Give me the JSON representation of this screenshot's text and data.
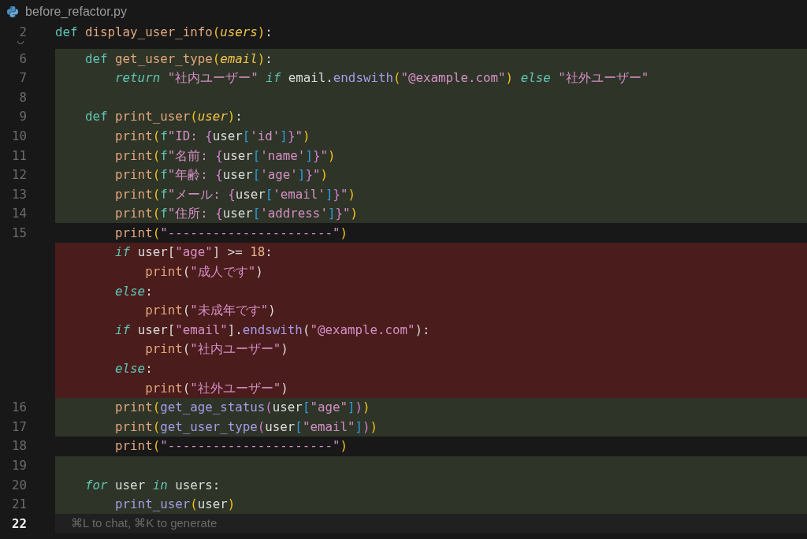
{
  "tab": {
    "title": "before_refactor.py"
  },
  "lines": [
    {
      "number": "2",
      "kind": "normal",
      "tokens": [
        {
          "kind": "kw",
          "text": "def "
        },
        {
          "kind": "fn",
          "text": "display_user_info"
        },
        {
          "kind": "p1",
          "text": "("
        },
        {
          "kind": "param",
          "text": "users"
        },
        {
          "kind": "p1",
          "text": ")"
        },
        {
          "kind": "id",
          "text": ":"
        }
      ]
    },
    {
      "number": "6",
      "kind": "added",
      "folded_before": true,
      "tokens": [
        {
          "kind": "kw",
          "text": "    def "
        },
        {
          "kind": "fn",
          "text": "get_user_type"
        },
        {
          "kind": "p1",
          "text": "("
        },
        {
          "kind": "param",
          "text": "email"
        },
        {
          "kind": "p1",
          "text": ")"
        },
        {
          "kind": "id",
          "text": ":"
        }
      ]
    },
    {
      "number": "7",
      "kind": "added",
      "tokens": [
        {
          "kind": "kwi",
          "text": "        return "
        },
        {
          "kind": "str",
          "text": "\"社内ユーザー\" "
        },
        {
          "kind": "kwi",
          "text": "if "
        },
        {
          "kind": "id",
          "text": "email."
        },
        {
          "kind": "method",
          "text": "endswith"
        },
        {
          "kind": "p1",
          "text": "("
        },
        {
          "kind": "str",
          "text": "\"@example.com\""
        },
        {
          "kind": "p1",
          "text": ")"
        },
        {
          "kind": "kwi",
          "text": " else "
        },
        {
          "kind": "str",
          "text": "\"社外ユーザー\""
        }
      ]
    },
    {
      "number": "8",
      "kind": "added"
    },
    {
      "number": "9",
      "kind": "added",
      "tokens": [
        {
          "kind": "kw",
          "text": "    def "
        },
        {
          "kind": "fn",
          "text": "print_user"
        },
        {
          "kind": "p1",
          "text": "("
        },
        {
          "kind": "param",
          "text": "user"
        },
        {
          "kind": "p1",
          "text": ")"
        },
        {
          "kind": "id",
          "text": ":"
        }
      ]
    },
    {
      "number": "10",
      "kind": "added",
      "tokens": [
        {
          "kind": "fn",
          "text": "        print"
        },
        {
          "kind": "p1",
          "text": "("
        },
        {
          "kind": "kw",
          "text": "f"
        },
        {
          "kind": "str",
          "text": "\"ID: "
        },
        {
          "kind": "p2",
          "text": "{"
        },
        {
          "kind": "id",
          "text": "user"
        },
        {
          "kind": "p3",
          "text": "["
        },
        {
          "kind": "str",
          "text": "'id'"
        },
        {
          "kind": "p3",
          "text": "]"
        },
        {
          "kind": "p2",
          "text": "}"
        },
        {
          "kind": "str",
          "text": "\""
        },
        {
          "kind": "p1",
          "text": ")"
        }
      ]
    },
    {
      "number": "11",
      "kind": "added",
      "tokens": [
        {
          "kind": "fn",
          "text": "        print"
        },
        {
          "kind": "p1",
          "text": "("
        },
        {
          "kind": "kw",
          "text": "f"
        },
        {
          "kind": "str",
          "text": "\"名前: "
        },
        {
          "kind": "p2",
          "text": "{"
        },
        {
          "kind": "id",
          "text": "user"
        },
        {
          "kind": "p3",
          "text": "["
        },
        {
          "kind": "str",
          "text": "'name'"
        },
        {
          "kind": "p3",
          "text": "]"
        },
        {
          "kind": "p2",
          "text": "}"
        },
        {
          "kind": "str",
          "text": "\""
        },
        {
          "kind": "p1",
          "text": ")"
        }
      ]
    },
    {
      "number": "12",
      "kind": "added",
      "tokens": [
        {
          "kind": "fn",
          "text": "        print"
        },
        {
          "kind": "p1",
          "text": "("
        },
        {
          "kind": "kw",
          "text": "f"
        },
        {
          "kind": "str",
          "text": "\"年齢: "
        },
        {
          "kind": "p2",
          "text": "{"
        },
        {
          "kind": "id",
          "text": "user"
        },
        {
          "kind": "p3",
          "text": "["
        },
        {
          "kind": "str",
          "text": "'age'"
        },
        {
          "kind": "p3",
          "text": "]"
        },
        {
          "kind": "p2",
          "text": "}"
        },
        {
          "kind": "str",
          "text": "\""
        },
        {
          "kind": "p1",
          "text": ")"
        }
      ]
    },
    {
      "number": "13",
      "kind": "added",
      "tokens": [
        {
          "kind": "fn",
          "text": "        print"
        },
        {
          "kind": "p1",
          "text": "("
        },
        {
          "kind": "kw",
          "text": "f"
        },
        {
          "kind": "str",
          "text": "\"メール: "
        },
        {
          "kind": "p2",
          "text": "{"
        },
        {
          "kind": "id",
          "text": "user"
        },
        {
          "kind": "p3",
          "text": "["
        },
        {
          "kind": "str",
          "text": "'email'"
        },
        {
          "kind": "p3",
          "text": "]"
        },
        {
          "kind": "p2",
          "text": "}"
        },
        {
          "kind": "str",
          "text": "\""
        },
        {
          "kind": "p1",
          "text": ")"
        }
      ]
    },
    {
      "number": "14",
      "kind": "added",
      "tokens": [
        {
          "kind": "fn",
          "text": "        print"
        },
        {
          "kind": "p1",
          "text": "("
        },
        {
          "kind": "kw",
          "text": "f"
        },
        {
          "kind": "str",
          "text": "\"住所: "
        },
        {
          "kind": "p2",
          "text": "{"
        },
        {
          "kind": "id",
          "text": "user"
        },
        {
          "kind": "p3",
          "text": "["
        },
        {
          "kind": "str",
          "text": "'address'"
        },
        {
          "kind": "p3",
          "text": "]"
        },
        {
          "kind": "p2",
          "text": "}"
        },
        {
          "kind": "str",
          "text": "\""
        },
        {
          "kind": "p1",
          "text": ")"
        }
      ]
    },
    {
      "number": "15",
      "kind": "normal",
      "tokens": [
        {
          "kind": "fn",
          "text": "        print"
        },
        {
          "kind": "p1",
          "text": "("
        },
        {
          "kind": "str",
          "text": "\"----------------------\""
        },
        {
          "kind": "p1",
          "text": ")"
        }
      ]
    },
    {
      "kind": "removed",
      "tokens": [
        {
          "kind": "kwi",
          "text": "        if "
        },
        {
          "kind": "id",
          "text": "user["
        },
        {
          "kind": "str",
          "text": "\"age\""
        },
        {
          "kind": "id",
          "text": "] >= "
        },
        {
          "kind": "num",
          "text": "18"
        },
        {
          "kind": "id",
          "text": ":"
        }
      ]
    },
    {
      "kind": "removed",
      "tokens": [
        {
          "kind": "fn",
          "text": "            print"
        },
        {
          "kind": "id",
          "text": "("
        },
        {
          "kind": "str",
          "text": "\"成人です\""
        },
        {
          "kind": "id",
          "text": ")"
        }
      ]
    },
    {
      "kind": "removed",
      "tokens": [
        {
          "kind": "kwi",
          "text": "        else"
        },
        {
          "kind": "id",
          "text": ":"
        }
      ]
    },
    {
      "kind": "removed",
      "tokens": [
        {
          "kind": "fn",
          "text": "            print"
        },
        {
          "kind": "id",
          "text": "("
        },
        {
          "kind": "str",
          "text": "\"未成年です\""
        },
        {
          "kind": "id",
          "text": ")"
        }
      ]
    },
    {
      "kind": "removed",
      "tokens": [
        {
          "kind": "kwi",
          "text": "        if "
        },
        {
          "kind": "id",
          "text": "user["
        },
        {
          "kind": "str",
          "text": "\"email\""
        },
        {
          "kind": "id",
          "text": "]."
        },
        {
          "kind": "method",
          "text": "endswith"
        },
        {
          "kind": "id",
          "text": "("
        },
        {
          "kind": "str",
          "text": "\"@example.com\""
        },
        {
          "kind": "id",
          "text": "):"
        }
      ]
    },
    {
      "kind": "removed",
      "tokens": [
        {
          "kind": "fn",
          "text": "            print"
        },
        {
          "kind": "id",
          "text": "("
        },
        {
          "kind": "str",
          "text": "\"社内ユーザー\""
        },
        {
          "kind": "id",
          "text": ")"
        }
      ]
    },
    {
      "kind": "removed",
      "tokens": [
        {
          "kind": "kwi",
          "text": "        else"
        },
        {
          "kind": "id",
          "text": ":"
        }
      ]
    },
    {
      "kind": "removed",
      "tokens": [
        {
          "kind": "fn",
          "text": "            print"
        },
        {
          "kind": "id",
          "text": "("
        },
        {
          "kind": "str",
          "text": "\"社外ユーザー\""
        },
        {
          "kind": "id",
          "text": ")"
        }
      ]
    },
    {
      "number": "16",
      "kind": "added",
      "tokens": [
        {
          "kind": "fn",
          "text": "        print"
        },
        {
          "kind": "p1",
          "text": "("
        },
        {
          "kind": "method",
          "text": "get_age_status"
        },
        {
          "kind": "p2",
          "text": "("
        },
        {
          "kind": "id",
          "text": "user"
        },
        {
          "kind": "p3",
          "text": "["
        },
        {
          "kind": "str",
          "text": "\"age\""
        },
        {
          "kind": "p3",
          "text": "]"
        },
        {
          "kind": "p2",
          "text": ")"
        },
        {
          "kind": "p1",
          "text": ")"
        }
      ]
    },
    {
      "number": "17",
      "kind": "added",
      "tokens": [
        {
          "kind": "fn",
          "text": "        print"
        },
        {
          "kind": "p1",
          "text": "("
        },
        {
          "kind": "method",
          "text": "get_user_type"
        },
        {
          "kind": "p2",
          "text": "("
        },
        {
          "kind": "id",
          "text": "user"
        },
        {
          "kind": "p3",
          "text": "["
        },
        {
          "kind": "str",
          "text": "\"email\""
        },
        {
          "kind": "p3",
          "text": "]"
        },
        {
          "kind": "p2",
          "text": ")"
        },
        {
          "kind": "p1",
          "text": ")"
        }
      ]
    },
    {
      "number": "18",
      "kind": "normal",
      "tokens": [
        {
          "kind": "fn",
          "text": "        print"
        },
        {
          "kind": "p1",
          "text": "("
        },
        {
          "kind": "str",
          "text": "\"----------------------\""
        },
        {
          "kind": "p1",
          "text": ")"
        }
      ]
    },
    {
      "number": "19",
      "kind": "added"
    },
    {
      "number": "20",
      "kind": "added",
      "tokens": [
        {
          "kind": "kwi",
          "text": "    for "
        },
        {
          "kind": "id",
          "text": "user "
        },
        {
          "kind": "kwi",
          "text": "in "
        },
        {
          "kind": "id",
          "text": "users:"
        }
      ]
    },
    {
      "number": "21",
      "kind": "added",
      "tokens": [
        {
          "kind": "method",
          "text": "        print_user"
        },
        {
          "kind": "p1",
          "text": "("
        },
        {
          "kind": "id",
          "text": "user"
        },
        {
          "kind": "p1",
          "text": ")"
        }
      ]
    },
    {
      "number": "22",
      "kind": "current",
      "hint": "⌘L to chat, ⌘K to generate"
    }
  ]
}
